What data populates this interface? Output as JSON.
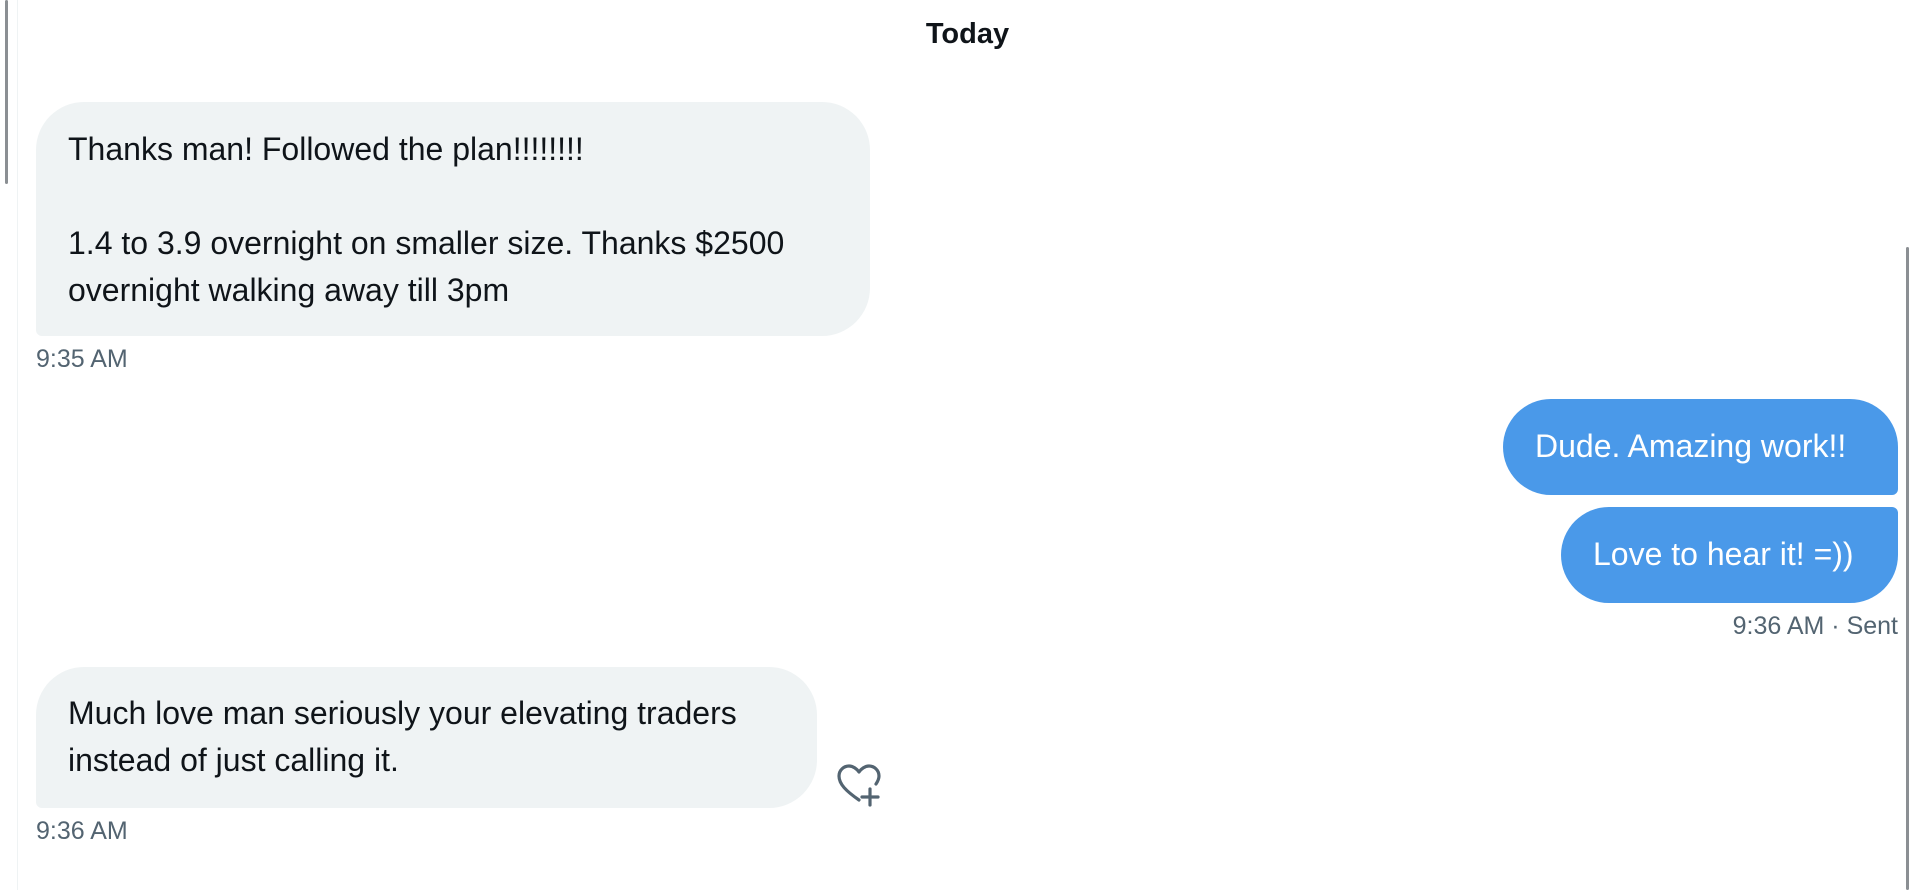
{
  "conversation": {
    "date_divider": "Today",
    "messages": [
      {
        "direction": "received",
        "text": "Thanks man! Followed the plan!!!!!!!!\n\n1.4 to 3.9 overnight on smaller size. Thanks $2500 overnight walking away till 3pm",
        "time": "9:35 AM"
      },
      {
        "direction": "sent",
        "text": "Dude. Amazing work!!"
      },
      {
        "direction": "sent",
        "text": "Love to hear it! =))",
        "time": "9:36 AM · Sent"
      },
      {
        "direction": "received",
        "text": "Much love man seriously your elevating traders instead of just calling it.",
        "time": "9:36 AM",
        "reaction_icon": "heart-plus-icon"
      }
    ]
  },
  "colors": {
    "received_bubble": "#eff3f4",
    "sent_bubble": "#4a99e9",
    "timestamp": "#536471",
    "text": "#0f1419"
  }
}
